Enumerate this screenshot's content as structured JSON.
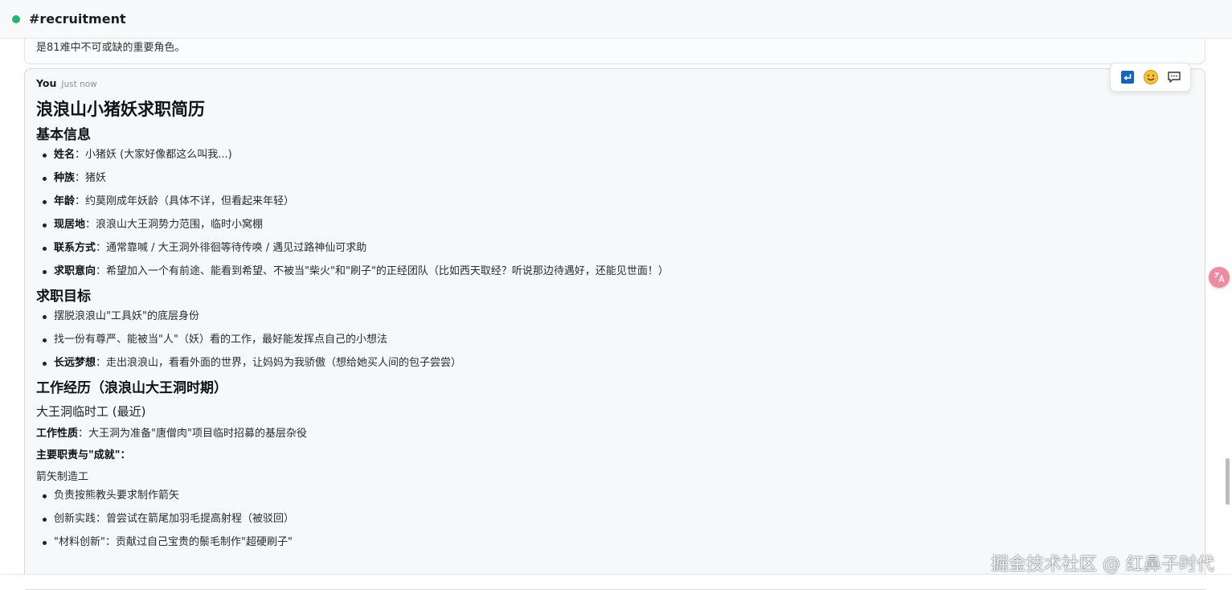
{
  "header": {
    "channel": "#recruitment",
    "status_color": "#22b573"
  },
  "previous_message": {
    "text": "是81难中不可或缺的重要角色。"
  },
  "message": {
    "author": "You",
    "timestamp": "Just now",
    "title": "浪浪山小猪妖求职简历",
    "sections": {
      "basic": {
        "heading": "基本信息",
        "items": [
          {
            "label": "姓名",
            "value": "：小猪妖 (大家好像都这么叫我...)"
          },
          {
            "label": "种族",
            "value": "：猪妖"
          },
          {
            "label": "年龄",
            "value": "：约莫刚成年妖龄（具体不详，但看起来年轻）"
          },
          {
            "label": "现居地",
            "value": "：浪浪山大王洞势力范围，临时小窝棚"
          },
          {
            "label": "联系方式",
            "value": "：通常靠喊 / 大王洞外徘徊等待传唤 / 遇见过路神仙可求助"
          },
          {
            "label": "求职意向",
            "value": "：希望加入一个有前途、能看到希望、不被当\"柴火\"和\"刷子\"的正经团队（比如西天取经？听说那边待遇好，还能见世面！）"
          }
        ]
      },
      "goals": {
        "heading": "求职目标",
        "items": [
          {
            "label": "",
            "value": "摆脱浪浪山\"工具妖\"的底层身份"
          },
          {
            "label": "",
            "value": "找一份有尊严、能被当\"人\"（妖）看的工作，最好能发挥点自己的小想法"
          },
          {
            "label": "长远梦想",
            "value": "：走出浪浪山，看看外面的世界，让妈妈为我骄傲（想给她买人间的包子尝尝）"
          }
        ]
      },
      "experience": {
        "heading": "工作经历（浪浪山大王洞时期）",
        "job_title": "大王洞临时工 (最近)",
        "nature_label": "工作性质",
        "nature_value": "：大王洞为准备\"唐僧肉\"项目临时招募的基层杂役",
        "duties_label": "主要职责与\"成就\"",
        "duties_colon": "：",
        "sub_role": "箭矢制造工",
        "items": [
          {
            "label": "",
            "value": "负责按熊教头要求制作箭矢"
          },
          {
            "label": "",
            "value": "创新实践：曾尝试在箭尾加羽毛提高射程（被驳回）"
          },
          {
            "label": "",
            "value": "\"材料创新\"：贡献过自己宝贵的鬃毛制作\"超硬刷子\""
          }
        ]
      }
    }
  },
  "actions": {
    "reply_icon": "reply-icon",
    "emoji_icon": "emoji-icon",
    "thread_icon": "comment-icon"
  },
  "translate_icon": "translate-icon",
  "watermark": "掘金技术社区 @ 红鼻子时代"
}
